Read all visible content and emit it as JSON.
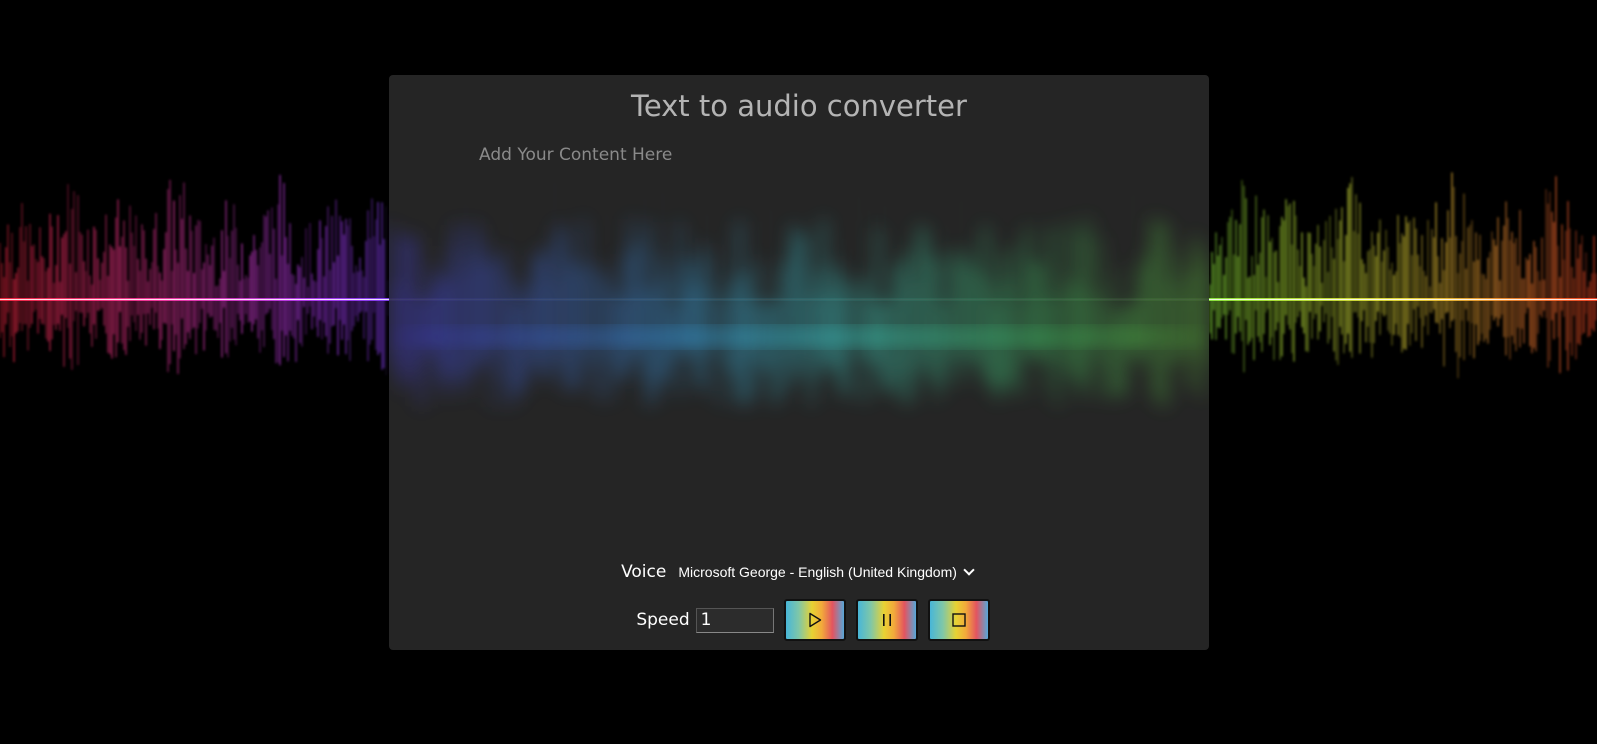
{
  "app": {
    "title": "Text to audio converter"
  },
  "editor": {
    "placeholder": "Add Your Content Here",
    "value": ""
  },
  "voice": {
    "label": "Voice",
    "selected": "Microsoft George - English (United Kingdom)"
  },
  "speed": {
    "label": "Speed",
    "value": "1"
  },
  "controls": {
    "play_icon": "play-icon",
    "pause_icon": "pause-icon",
    "stop_icon": "stop-icon"
  },
  "colors": {
    "background": "#000000",
    "panel": "#282828",
    "title_text": "#b4b4b4",
    "wave_start": "#ff2a4a",
    "wave_mid": "#40e0e0",
    "wave_end": "#ff5a2a"
  }
}
